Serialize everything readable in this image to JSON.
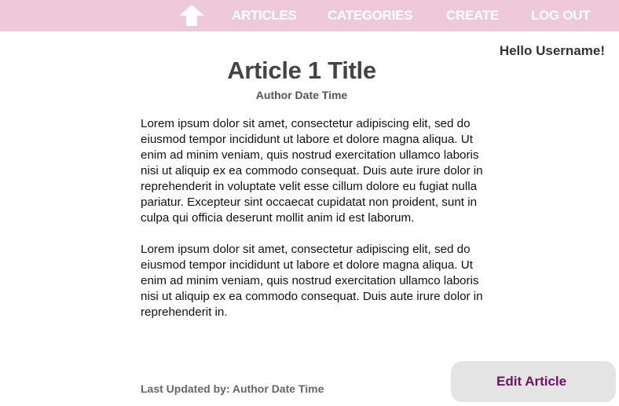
{
  "nav": {
    "home_icon": "up-arrow-home-icon",
    "links": [
      "ARTICLES",
      "CATEGORIES",
      "CREATE",
      "LOG OUT"
    ]
  },
  "greeting": "Hello Username!",
  "article": {
    "title": "Article 1 Title",
    "byline": "Author Date Time",
    "paragraphs": [
      "Lorem ipsum dolor sit amet, consectetur adipiscing elit, sed do eiusmod tempor incididunt ut labore et dolore magna aliqua. Ut enim ad minim veniam, quis nostrud exercitation ullamco laboris nisi ut aliquip ex ea commodo consequat. Duis aute irure dolor in reprehenderit in voluptate velit esse cillum dolore eu fugiat nulla pariatur. Excepteur sint occaecat cupidatat non proident, sunt in culpa qui officia deserunt mollit anim id est laborum.",
      "Lorem ipsum dolor sit amet, consectetur adipiscing elit, sed do eiusmod tempor incididunt ut labore et dolore magna aliqua. Ut enim ad minim veniam, quis nostrud exercitation ullamco laboris nisi ut aliquip ex ea commodo consequat. Duis aute irure dolor in reprehenderit in."
    ],
    "last_updated": "Last Updated by: Author Date Time"
  },
  "edit_button_label": "Edit Article",
  "colors": {
    "nav_background": "#edc9da",
    "nav_text": "#ffffff",
    "button_background": "#e4e4e4",
    "button_text": "#6a1460"
  }
}
